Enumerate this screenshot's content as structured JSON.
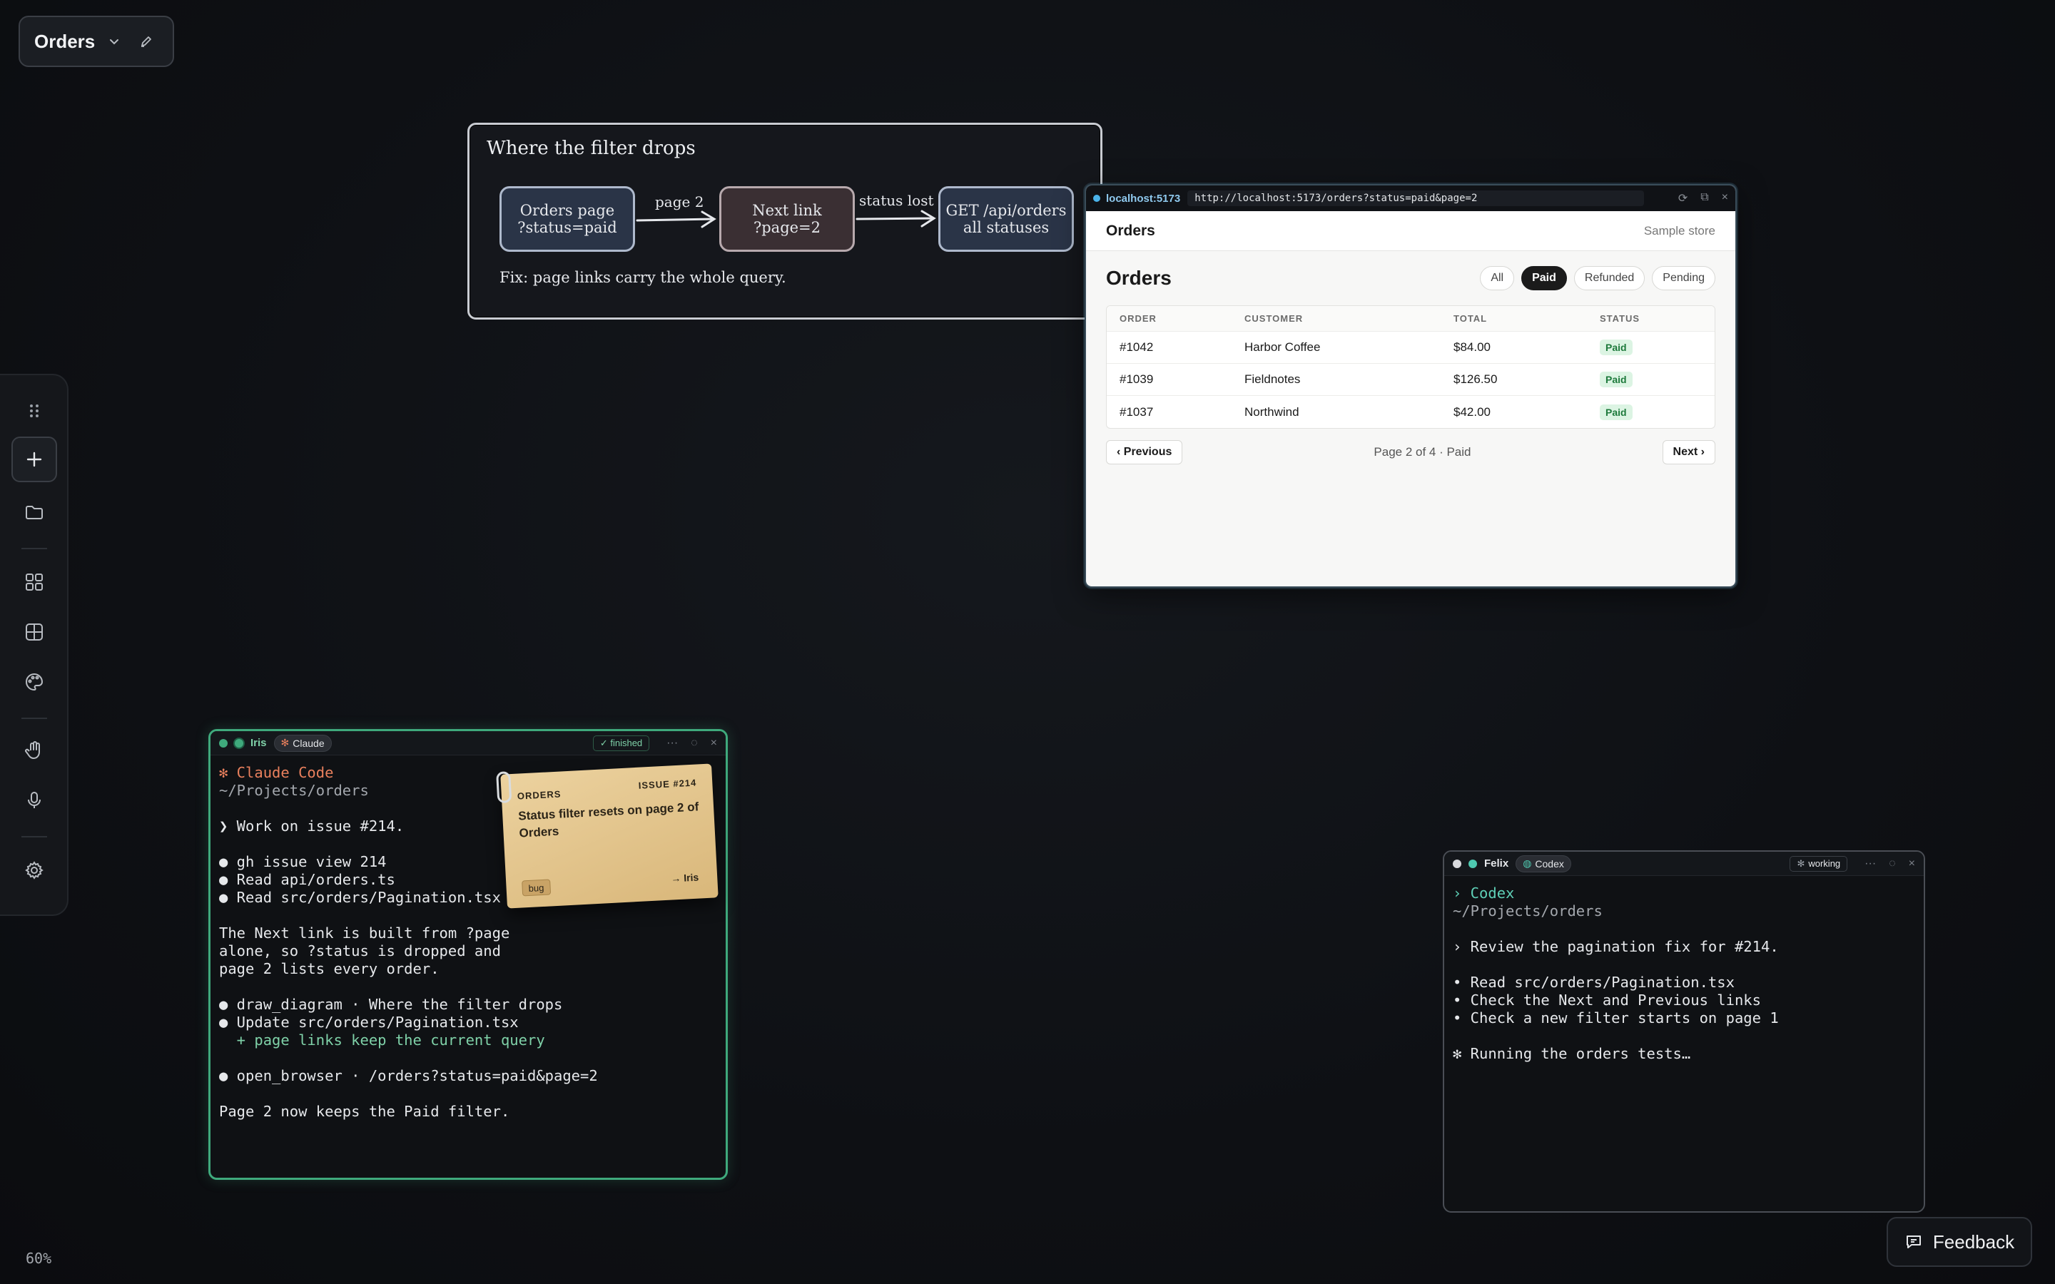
{
  "workspace": {
    "title": "Orders"
  },
  "zoom": "60%",
  "feedback": {
    "label": "Feedback"
  },
  "diagram": {
    "title": "Where the filter drops",
    "nodes": [
      {
        "line1": "Orders page",
        "line2": "?status=paid"
      },
      {
        "line1": "Next link",
        "line2": "?page=2"
      },
      {
        "line1": "GET /api/orders",
        "line2": "all statuses"
      }
    ],
    "edges": [
      "page 2",
      "status lost"
    ],
    "note": "Fix: page links carry the whole query."
  },
  "browser": {
    "host": "localhost:5173",
    "url": "http://localhost:5173/orders?status=paid&page=2",
    "brand": "Orders",
    "store": "Sample store",
    "heading": "Orders",
    "filters": [
      "All",
      "Paid",
      "Refunded",
      "Pending"
    ],
    "active_filter": "Paid",
    "columns": [
      "ORDER",
      "CUSTOMER",
      "TOTAL",
      "STATUS"
    ],
    "rows": [
      {
        "order": "#1042",
        "customer": "Harbor Coffee",
        "total": "$84.00",
        "status": "Paid"
      },
      {
        "order": "#1039",
        "customer": "Fieldnotes",
        "total": "$126.50",
        "status": "Paid"
      },
      {
        "order": "#1037",
        "customer": "Northwind",
        "total": "$42.00",
        "status": "Paid"
      }
    ],
    "prev": "‹ Previous",
    "page_info": "Page 2 of 4 · Paid",
    "next": "Next ›"
  },
  "iris": {
    "agent": "Iris",
    "model": "Claude",
    "state": "✓ finished",
    "accent": "#3fa97c",
    "lines": [
      {
        "text": "✻ Claude Code",
        "cls": "orange"
      },
      {
        "text": "~/Projects/orders",
        "cls": "dim"
      },
      {
        "text": "",
        "cls": ""
      },
      {
        "text": "❯ Work on issue #214.",
        "cls": ""
      },
      {
        "text": "",
        "cls": ""
      },
      {
        "text": "● gh issue view 214",
        "cls": ""
      },
      {
        "text": "● Read api/orders.ts",
        "cls": ""
      },
      {
        "text": "● Read src/orders/Pagination.tsx",
        "cls": ""
      },
      {
        "text": "",
        "cls": ""
      },
      {
        "text": "The Next link is built from ?page",
        "cls": ""
      },
      {
        "text": "alone, so ?status is dropped and",
        "cls": ""
      },
      {
        "text": "page 2 lists every order.",
        "cls": ""
      },
      {
        "text": "",
        "cls": ""
      },
      {
        "text": "● draw_diagram · Where the filter drops",
        "cls": ""
      },
      {
        "text": "● Update src/orders/Pagination.tsx",
        "cls": ""
      },
      {
        "text": "  + page links keep the current query",
        "cls": "green"
      },
      {
        "text": "",
        "cls": ""
      },
      {
        "text": "● open_browser · /orders?status=paid&page=2",
        "cls": ""
      },
      {
        "text": "",
        "cls": ""
      },
      {
        "text": "Page 2 now keeps the Paid filter.",
        "cls": ""
      }
    ]
  },
  "felix": {
    "agent": "Felix",
    "model": "Codex",
    "state": "working",
    "lines": [
      {
        "text": "› Codex",
        "cls": "teal"
      },
      {
        "text": "~/Projects/orders",
        "cls": "dim"
      },
      {
        "text": "",
        "cls": ""
      },
      {
        "text": "› Review the pagination fix for #214.",
        "cls": ""
      },
      {
        "text": "",
        "cls": ""
      },
      {
        "text": "• Read src/orders/Pagination.tsx",
        "cls": ""
      },
      {
        "text": "• Check the Next and Previous links",
        "cls": ""
      },
      {
        "text": "• Check a new filter starts on page 1",
        "cls": ""
      },
      {
        "text": "",
        "cls": ""
      },
      {
        "text": "✻ Running the orders tests…",
        "cls": ""
      }
    ]
  },
  "sticky": {
    "kind": "ORDERS",
    "issue": "ISSUE #214",
    "title": "Status filter resets on page 2 of Orders",
    "label": "bug",
    "assignee": "→ Iris"
  }
}
